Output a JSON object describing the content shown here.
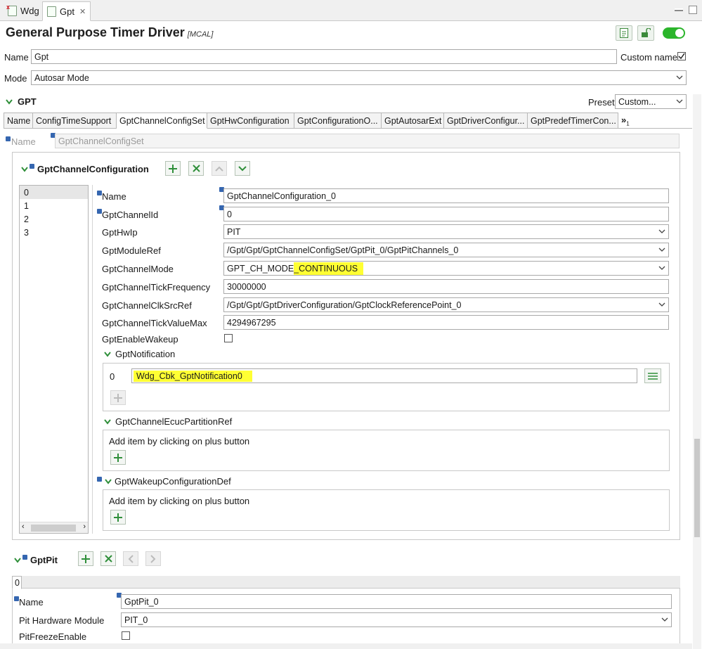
{
  "editor_tabs": [
    {
      "label": "Wdg"
    },
    {
      "label": "Gpt"
    }
  ],
  "header": {
    "title": "General Purpose Timer Driver",
    "subtitle": "[MCAL]"
  },
  "name_row": {
    "label": "Name",
    "value": "Gpt",
    "custom_name_label": "Custom name",
    "custom_name_checked": true
  },
  "mode_row": {
    "label": "Mode",
    "value": "Autosar Mode"
  },
  "gpt_section": {
    "title": "GPT",
    "preset_label": "Preset",
    "preset_value": "Custom..."
  },
  "tabs": [
    {
      "label": "Name"
    },
    {
      "label": "ConfigTimeSupport"
    },
    {
      "label": "GptChannelConfigSet"
    },
    {
      "label": "GptHwConfiguration"
    },
    {
      "label": "GptConfigurationO..."
    },
    {
      "label": "GptAutosarExt"
    },
    {
      "label": "GptDriverConfigur..."
    },
    {
      "label": "GptPredefTimerCon..."
    }
  ],
  "tabs_overflow": {
    "label": "»",
    "count": "1"
  },
  "configset": {
    "name_label": "Name",
    "name_value": "GptChannelConfigSet"
  },
  "channel_config": {
    "title": "GptChannelConfiguration",
    "list": [
      "0",
      "1",
      "2",
      "3"
    ],
    "selected_index": 0,
    "fields": {
      "name": {
        "label": "Name",
        "value": "GptChannelConfiguration_0"
      },
      "channel_id": {
        "label": "GptChannelId",
        "value": "0"
      },
      "hw_ip": {
        "label": "GptHwIp",
        "value": "PIT"
      },
      "module_ref": {
        "label": "GptModuleRef",
        "value": "/Gpt/Gpt/GptChannelConfigSet/GptPit_0/GptPitChannels_0"
      },
      "channel_mode": {
        "label": "GptChannelMode",
        "value_prefix": "GPT_CH_MODE",
        "value_highlight": "_CONTINUOUS"
      },
      "tick_frequency": {
        "label": "GptChannelTickFrequency",
        "value": "30000000"
      },
      "clk_src_ref": {
        "label": "GptChannelClkSrcRef",
        "value": "/Gpt/Gpt/GptDriverConfiguration/GptClockReferencePoint_0"
      },
      "tick_value_max": {
        "label": "GptChannelTickValueMax",
        "value": "4294967295"
      },
      "enable_wakeup": {
        "label": "GptEnableWakeup",
        "checked": false
      }
    },
    "notification": {
      "title": "GptNotification",
      "index": "0",
      "value": "Wdg_Cbk_GptNotification0"
    },
    "ecuc_partition": {
      "title": "GptChannelEcucPartitionRef",
      "hint": "Add item by clicking on plus button"
    },
    "wakeup_def": {
      "title": "GptWakeupConfigurationDef",
      "hint": "Add item by clicking on plus button"
    }
  },
  "gpt_pit": {
    "title": "GptPit",
    "tab_label": "0",
    "name": {
      "label": "Name",
      "value": "GptPit_0"
    },
    "hw_module": {
      "label": "Pit Hardware Module",
      "value": "PIT_0"
    },
    "freeze": {
      "label": "PitFreezeEnable",
      "checked": false
    }
  },
  "colors": {
    "accent_green": "#2f8f3a",
    "toggle_on": "#2bb52b",
    "highlight": "#ffff33",
    "info_blue": "#3566b0"
  }
}
